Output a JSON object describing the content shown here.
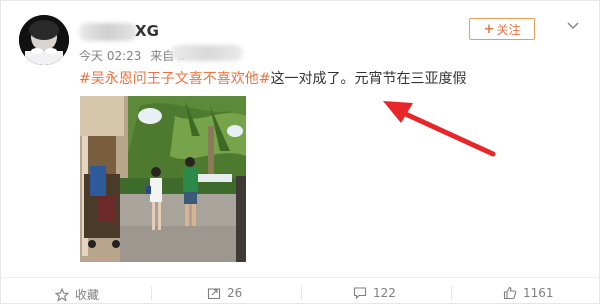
{
  "post": {
    "username_suffix": "XG",
    "time": "今天 02:23",
    "source_prefix": "来自 iP",
    "hashtag": "#吴永恩问王子文喜不喜欢他#",
    "body": "这一对成了。元宵节在三亚度假"
  },
  "follow": {
    "plus": "+",
    "label": "关注"
  },
  "actions": {
    "favorite_label": "收藏",
    "repost_count": "26",
    "comment_count": "122",
    "like_count": "1161"
  },
  "icons": [
    "avatar",
    "chevron-down-icon",
    "star-icon",
    "share-icon",
    "comment-icon",
    "like-icon"
  ]
}
